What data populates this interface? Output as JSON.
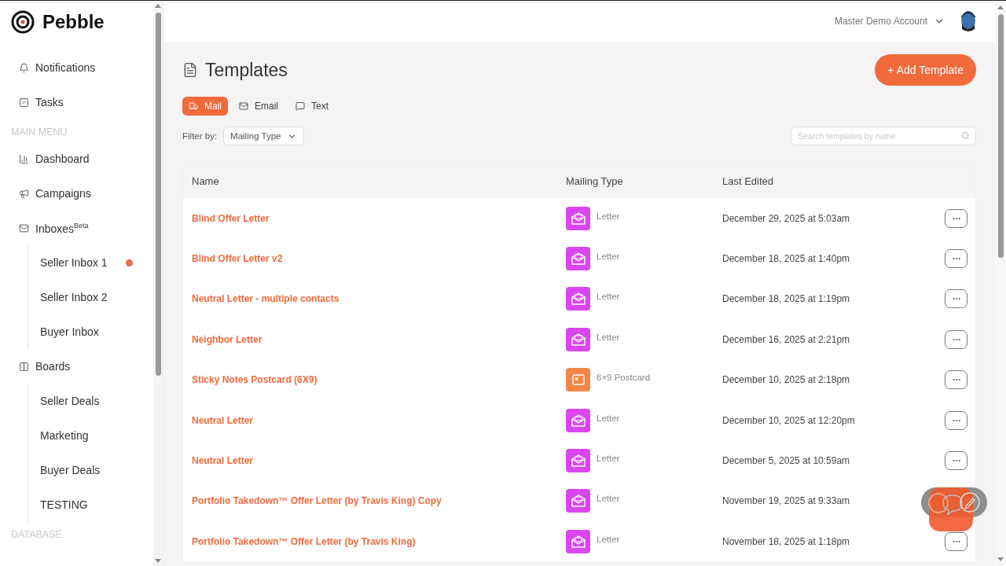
{
  "brand": {
    "name": "Pebble"
  },
  "sidebar": {
    "top_items": [
      {
        "label": "Notifications"
      },
      {
        "label": "Tasks"
      }
    ],
    "sections": [
      {
        "title": "MAIN MENU",
        "items": [
          {
            "label": "Dashboard"
          },
          {
            "label": "Campaigns"
          },
          {
            "label": "Inboxes$^{Beta}$",
            "children": [
              {
                "label": "Seller Inbox 1",
                "unread": true
              },
              {
                "label": "Seller Inbox 2",
                "unread": false
              },
              {
                "label": "Buyer Inbox",
                "unread": false
              }
            ]
          },
          {
            "label": "Boards",
            "children": [
              {
                "label": "Seller Deals",
                "unread": false
              },
              {
                "label": "Marketing",
                "unread": false
              },
              {
                "label": "Buyer Deals",
                "unread": false
              },
              {
                "label": "TESTING",
                "unread": false
              }
            ]
          }
        ]
      },
      {
        "title": "DATABASE"
      }
    ]
  },
  "account": {
    "name": "Master Demo Account"
  },
  "page": {
    "title": "Templates",
    "add_button": "+ Add Template"
  },
  "tabs": [
    {
      "label": "Mail",
      "selected": true
    },
    {
      "label": "Email",
      "selected": false
    },
    {
      "label": "Text",
      "selected": false
    }
  ],
  "filter": {
    "label": "Filter by:",
    "value": "Mailing Type"
  },
  "search": {
    "placeholder": "Search templates by name"
  },
  "table": {
    "columns": [
      "Name",
      "Mailing Type",
      "Last Edited"
    ],
    "rows": [
      {
        "name": "Blind Offer Letter",
        "mailing_type": {
          "kind": "letter",
          "label": "Letter"
        },
        "last_edited": "December 29, 2025 at 5:03am"
      },
      {
        "name": "Blind Offer Letter v2",
        "mailing_type": {
          "kind": "letter",
          "label": "Letter"
        },
        "last_edited": "December 18, 2025 at 1:40pm"
      },
      {
        "name": "Neutral Letter - multiple contacts",
        "mailing_type": {
          "kind": "letter",
          "label": "Letter"
        },
        "last_edited": "December 18, 2025 at 1:19pm"
      },
      {
        "name": "Neighbor Letter",
        "mailing_type": {
          "kind": "letter",
          "label": "Letter"
        },
        "last_edited": "December 16, 2025 at 2:21pm"
      },
      {
        "name": "Sticky Notes Postcard (6X9)",
        "mailing_type": {
          "kind": "postcard",
          "label": "6×9 Postcard"
        },
        "last_edited": "December 10, 2025 at 2:18pm"
      },
      {
        "name": "Neutral Letter",
        "mailing_type": {
          "kind": "letter",
          "label": "Letter"
        },
        "last_edited": "December 10, 2025 at 12:20pm"
      },
      {
        "name": "Neutral Letter",
        "mailing_type": {
          "kind": "letter",
          "label": "Letter"
        },
        "last_edited": "December 5, 2025 at 10:59am"
      },
      {
        "name": "Portfolio Takedown™ Offer Letter (by Travis King) Copy",
        "mailing_type": {
          "kind": "letter",
          "label": "Letter"
        },
        "last_edited": "November 19, 2025 at 9:33am"
      },
      {
        "name": "Portfolio Takedown™ Offer Letter (by Travis King)",
        "mailing_type": {
          "kind": "letter",
          "label": "Letter"
        },
        "last_edited": "November 18, 2025 at 1:18pm"
      }
    ]
  }
}
